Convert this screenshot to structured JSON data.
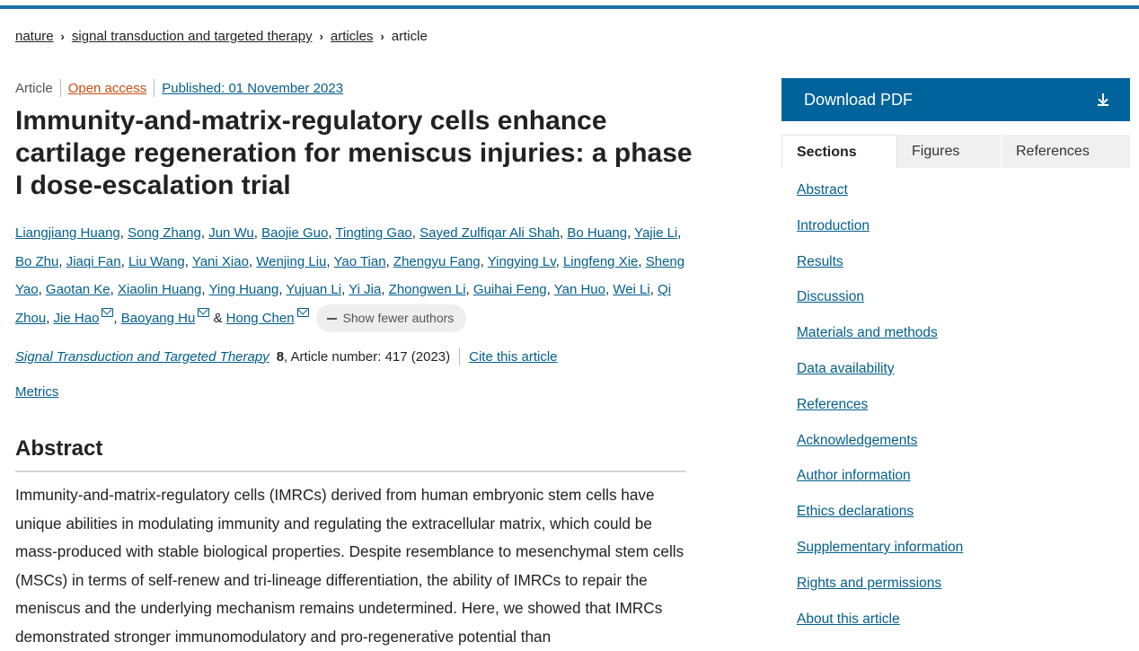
{
  "breadcrumb": {
    "items": [
      "nature",
      "signal transduction and targeted therapy",
      "articles",
      "article"
    ]
  },
  "meta": {
    "type": "Article",
    "open_access": "Open access",
    "published": "Published: 01 November 2023"
  },
  "title": "Immunity-and-matrix-regulatory cells enhance cartilage regeneration for meniscus injuries: a phase I dose-escalation trial",
  "authors": {
    "names": [
      "Liangjiang Huang",
      "Song Zhang",
      "Jun Wu",
      "Baojie Guo",
      "Tingting Gao",
      "Sayed Zulfiqar Ali Shah",
      "Bo Huang",
      "Yajie Li",
      "Bo Zhu",
      "Jiaqi Fan",
      "Liu Wang",
      "Yani Xiao",
      "Wenjing Liu",
      "Yao Tian",
      "Zhengyu Fang",
      "Yingying Lv",
      "Lingfeng Xie",
      "Sheng Yao",
      "Gaotan Ke",
      "Xiaolin Huang",
      "Ying Huang",
      "Yujuan Li",
      "Yi Jia",
      "Zhongwen Li",
      "Guihai Feng",
      "Yan Huo",
      "Wei Li",
      "Qi Zhou",
      "Jie Hao",
      "Baoyang Hu",
      "Hong Chen"
    ],
    "ampersand": "&",
    "show_fewer": "Show fewer authors"
  },
  "citation": {
    "journal": "Signal Transduction and Targeted Therapy",
    "volume": "8",
    "article_number": ", Article number: 417 (2023)",
    "cite": "Cite this article"
  },
  "metrics": "Metrics",
  "abstract": {
    "heading": "Abstract",
    "text": "Immunity-and-matrix-regulatory cells (IMRCs) derived from human embryonic stem cells have unique abilities in modulating immunity and regulating the extracellular matrix, which could be mass-produced with stable biological properties. Despite resemblance to mesenchymal stem cells (MSCs) in terms of self-renew and tri-lineage differentiation, the ability of IMRCs to repair the meniscus and the underlying mechanism remains undetermined. Here, we showed that IMRCs demonstrated stronger immunomodulatory and pro-regenerative potential than"
  },
  "sidebar": {
    "download": "Download PDF",
    "tabs": [
      "Sections",
      "Figures",
      "References"
    ],
    "sections": [
      "Abstract",
      "Introduction",
      "Results",
      "Discussion",
      "Materials and methods",
      "Data availability",
      "References",
      "Acknowledgements",
      "Author information",
      "Ethics declarations",
      "Supplementary information",
      "Rights and permissions",
      "About this article"
    ]
  },
  "colors": {
    "accent": "#01639b",
    "link": "#025e8d",
    "open_access": "#c94d12"
  }
}
